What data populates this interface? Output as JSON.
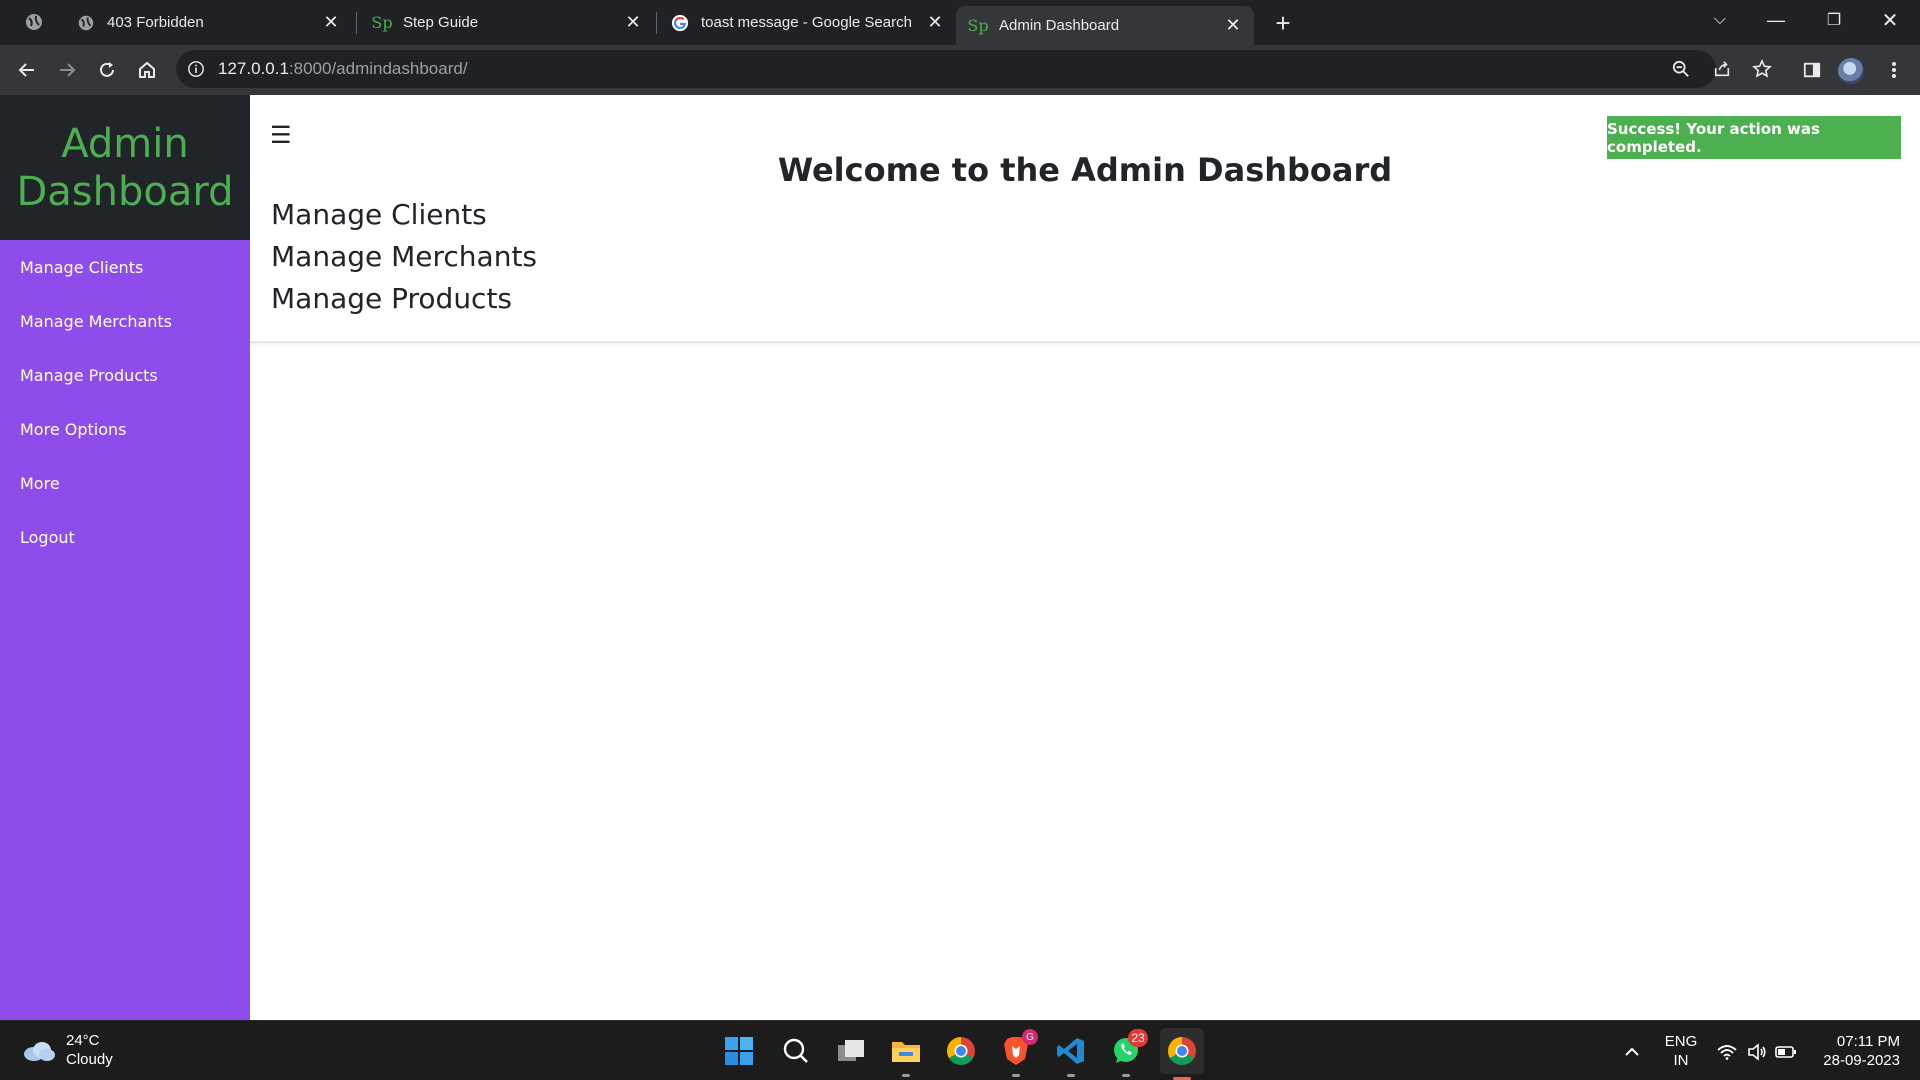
{
  "browser": {
    "tabs": [
      {
        "title": "403 Forbidden",
        "favicon": "globe-icon"
      },
      {
        "title": "Step Guide",
        "favicon": "sp-logo",
        "favicon_text": "Sp"
      },
      {
        "title": "toast message - Google Search",
        "favicon": "google-icon"
      },
      {
        "title": "Admin Dashboard",
        "favicon": "sp-logo",
        "favicon_text": "Sp",
        "active": true
      }
    ],
    "url_host": "127.0.0.1",
    "url_rest": ":8000/admindashboard/"
  },
  "sidebar": {
    "title": "Admin Dashboard",
    "items": [
      {
        "label": "Manage Clients"
      },
      {
        "label": "Manage Merchants"
      },
      {
        "label": "Manage Products"
      },
      {
        "label": "More Options"
      },
      {
        "label": "More"
      },
      {
        "label": "Logout"
      }
    ]
  },
  "main": {
    "menu_icon": "☰",
    "heading": "Welcome to the Admin Dashboard",
    "links": [
      {
        "label": "Manage Clients"
      },
      {
        "label": "Manage Merchants"
      },
      {
        "label": "Manage Products"
      }
    ],
    "toast": "Success! Your action was completed."
  },
  "taskbar": {
    "weather_temp": "24°C",
    "weather_desc": "Cloudy",
    "whatsapp_badge": "23",
    "lang_top": "ENG",
    "lang_bottom": "IN",
    "time": "07:11 PM",
    "date": "28-09-2023"
  },
  "colors": {
    "sidebar_bg": "#8e4deb",
    "sidebar_header_bg": "#212529",
    "title_green": "#4caf50",
    "toast_bg": "#4caf50"
  }
}
